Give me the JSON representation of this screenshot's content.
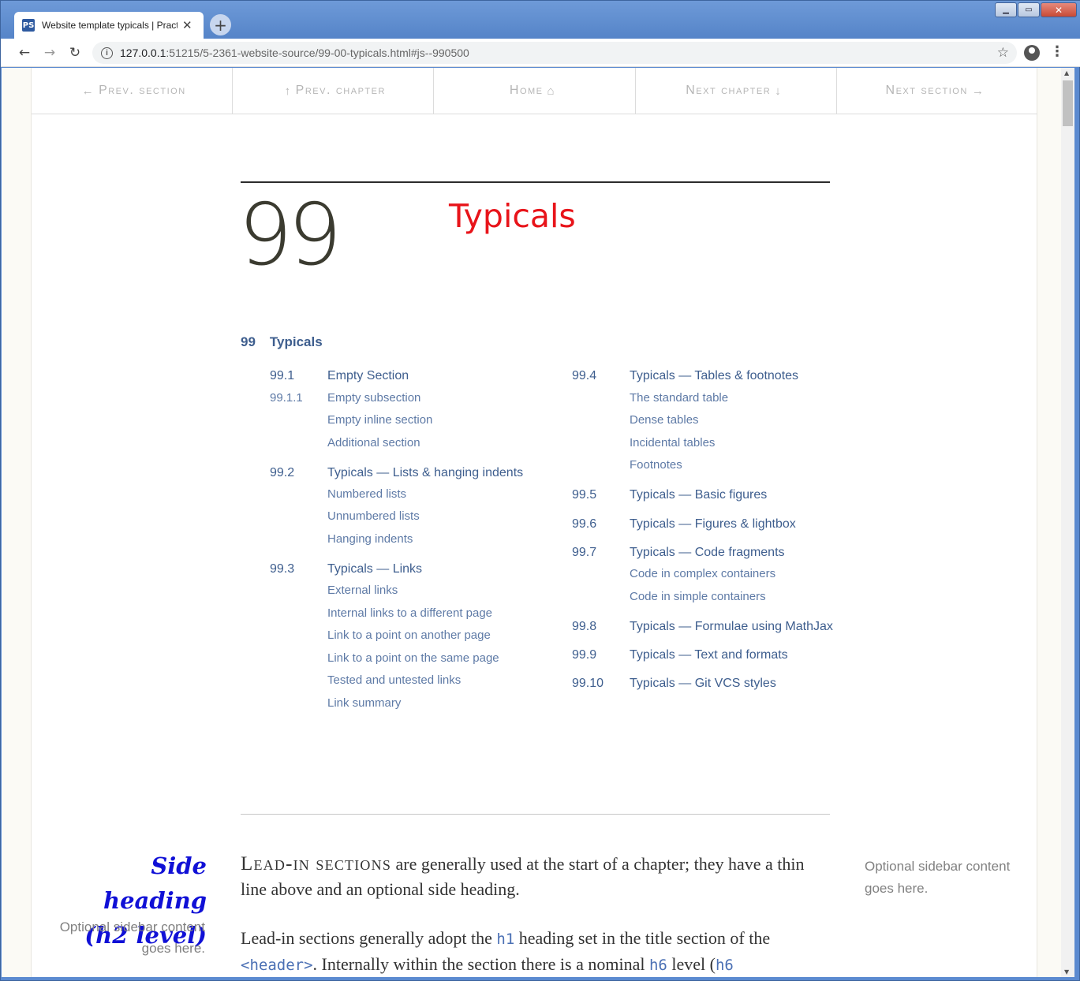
{
  "browser": {
    "tab_title": "Website template typicals | Practi",
    "url_host": "127.0.0.1",
    "url_rest": ":51215/5-2361-website-source/99-00-typicals.html#js--990500"
  },
  "nav": {
    "prev_section": "Prev. section",
    "prev_chapter": "Prev. chapter",
    "home": "Home",
    "next_chapter": "Next chapter",
    "next_section": "Next section"
  },
  "chapter": {
    "number": "99",
    "title": "Typicals"
  },
  "toc": {
    "root_num": "99",
    "root_title": "Typicals",
    "left": [
      {
        "num": "99.1",
        "title": "Empty Section",
        "subnum": "99.1.1",
        "subs": [
          "Empty subsection",
          "Empty inline section",
          "Additional section"
        ]
      },
      {
        "num": "99.2",
        "title": "Typicals — Lists & hanging indents",
        "subs": [
          "Numbered lists",
          "Unnumbered lists",
          "Hanging indents"
        ]
      },
      {
        "num": "99.3",
        "title": "Typicals — Links",
        "subs": [
          "External links",
          "Internal links to a different page",
          "Link to a point on another page",
          "Link to a point on the same page",
          "Tested and untested links",
          "Link summary"
        ]
      }
    ],
    "right": [
      {
        "num": "99.4",
        "title": "Typicals — Tables & footnotes",
        "subs": [
          "The standard table",
          "Dense tables",
          "Incidental tables",
          "Footnotes"
        ]
      },
      {
        "num": "99.5",
        "title": "Typicals — Basic figures",
        "subs": []
      },
      {
        "num": "99.6",
        "title": "Typicals — Figures & lightbox",
        "subs": []
      },
      {
        "num": "99.7",
        "title": "Typicals — Code fragments",
        "subs": [
          "Code in complex containers",
          "Code in simple containers"
        ]
      },
      {
        "num": "99.8",
        "title": "Typicals — Formulae using MathJax",
        "subs": []
      },
      {
        "num": "99.9",
        "title": "Typicals — Text and formats",
        "subs": []
      },
      {
        "num": "99.10",
        "title": "Typicals — Git VCS styles",
        "subs": []
      }
    ]
  },
  "lead_section": {
    "side_heading_line1": "Side heading",
    "side_heading_line2": "(h2 level)",
    "sidebar_left": "Optional sidebar content goes here.",
    "sidebar_right": "Optional sidebar content goes here.",
    "lead_caps": "Lead-in sections",
    "lead_text": " are generally used at the start of a chapter; they have a thin line above and an optional side heading.",
    "para_a": "Lead-in sections generally adopt the ",
    "para_code1": "h1",
    "para_b": " heading set in the title section of the ",
    "para_code2": "<header>",
    "para_c": ". Internally within the section there is a nominal ",
    "para_code3": "h6",
    "para_d": " level (",
    "para_code4": "h6"
  }
}
